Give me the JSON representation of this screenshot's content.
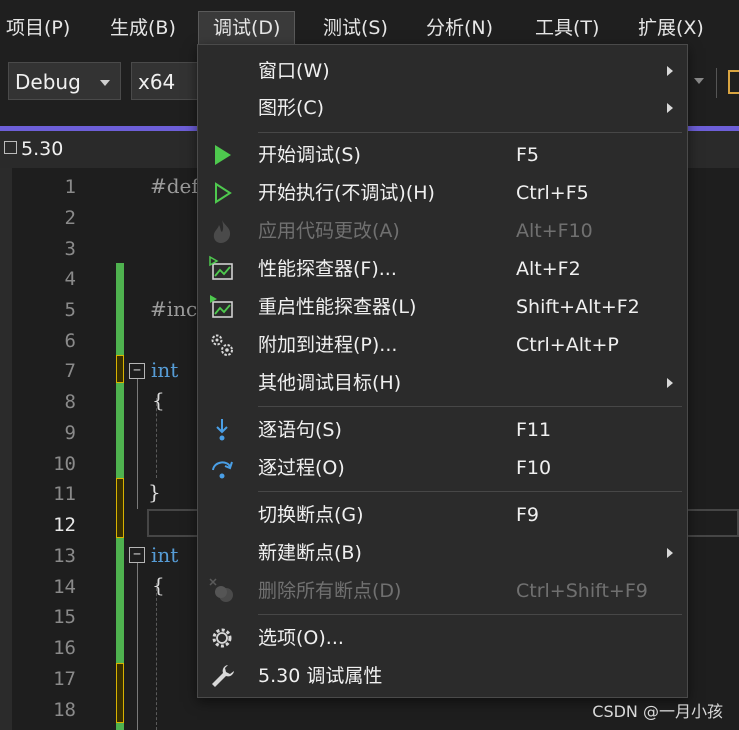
{
  "menubar": {
    "items": [
      "项目(P)",
      "生成(B)",
      "调试(D)",
      "测试(S)",
      "分析(N)",
      "工具(T)",
      "扩展(X)"
    ],
    "active_index": 2
  },
  "toolbar": {
    "config": "Debug",
    "platform": "x64"
  },
  "tab": {
    "title": "5.30"
  },
  "editor": {
    "line_numbers": [
      "1",
      "2",
      "3",
      "4",
      "5",
      "6",
      "7",
      "8",
      "9",
      "10",
      "11",
      "12",
      "13",
      "14",
      "15",
      "16",
      "17",
      "18"
    ],
    "current_line": "12",
    "lines": {
      "l1": "#def",
      "l5": "#inc",
      "l7": "int",
      "l8": "{",
      "l11": "}",
      "l13": "int",
      "l14": "{"
    }
  },
  "debug_menu": {
    "items": [
      {
        "label": "窗口(W)",
        "shortcut": "",
        "submenu": true,
        "enabled": true,
        "icon": "none"
      },
      {
        "label": "图形(C)",
        "shortcut": "",
        "submenu": true,
        "enabled": true,
        "icon": "none"
      },
      {
        "label": "开始调试(S)",
        "shortcut": "F5",
        "submenu": false,
        "enabled": true,
        "icon": "play-filled-icon"
      },
      {
        "label": "开始执行(不调试)(H)",
        "shortcut": "Ctrl+F5",
        "submenu": false,
        "enabled": true,
        "icon": "play-outline-icon"
      },
      {
        "label": "应用代码更改(A)",
        "shortcut": "Alt+F10",
        "submenu": false,
        "enabled": false,
        "icon": "flame-icon"
      },
      {
        "label": "性能探查器(F)...",
        "shortcut": "Alt+F2",
        "submenu": false,
        "enabled": true,
        "icon": "profiler-chart-icon"
      },
      {
        "label": "重启性能探查器(L)",
        "shortcut": "Shift+Alt+F2",
        "submenu": false,
        "enabled": true,
        "icon": "profiler-restart-icon"
      },
      {
        "label": "附加到进程(P)...",
        "shortcut": "Ctrl+Alt+P",
        "submenu": false,
        "enabled": true,
        "icon": "gears-icon"
      },
      {
        "label": "其他调试目标(H)",
        "shortcut": "",
        "submenu": true,
        "enabled": true,
        "icon": "none"
      },
      {
        "label": "逐语句(S)",
        "shortcut": "F11",
        "submenu": false,
        "enabled": true,
        "icon": "step-into-icon"
      },
      {
        "label": "逐过程(O)",
        "shortcut": "F10",
        "submenu": false,
        "enabled": true,
        "icon": "step-over-icon"
      },
      {
        "label": "切换断点(G)",
        "shortcut": "F9",
        "submenu": false,
        "enabled": true,
        "icon": "none"
      },
      {
        "label": "新建断点(B)",
        "shortcut": "",
        "submenu": true,
        "enabled": true,
        "icon": "none"
      },
      {
        "label": "删除所有断点(D)",
        "shortcut": "Ctrl+Shift+F9",
        "submenu": false,
        "enabled": false,
        "icon": "delete-breakpoints-icon"
      },
      {
        "label": "选项(O)...",
        "shortcut": "",
        "submenu": false,
        "enabled": true,
        "icon": "gear-icon"
      },
      {
        "label": "5.30 调试属性",
        "shortcut": "",
        "submenu": false,
        "enabled": true,
        "icon": "wrench-icon"
      }
    ]
  },
  "watermark": "CSDN @一月小孩",
  "colors": {
    "accent": "#6d5fd8",
    "play_green": "#4ec94e",
    "step_blue": "#4a9fe6",
    "change_bar_green": "#4fb24f",
    "keyword_blue": "#569cd6"
  }
}
